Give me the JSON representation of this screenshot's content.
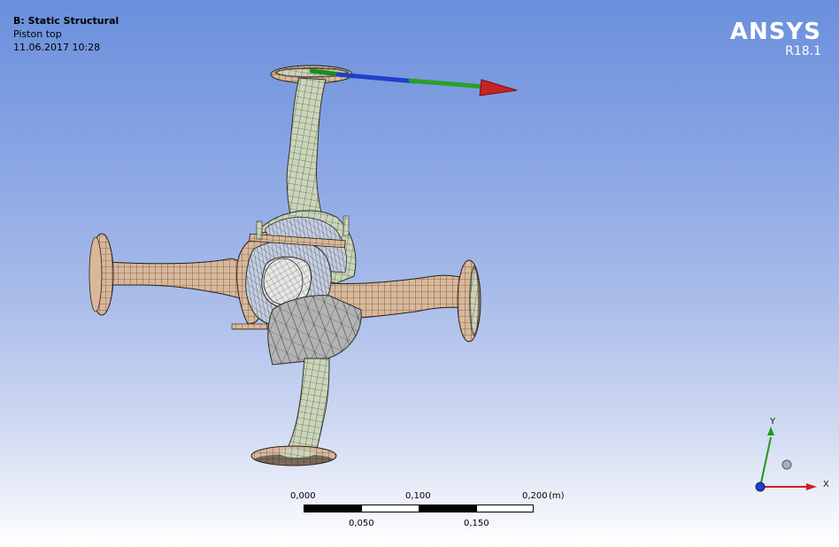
{
  "info": {
    "analysis_title": "B: Static Structural",
    "result_name": "Piston top",
    "timestamp": "11.06.2017 10:28"
  },
  "brand": {
    "logo": "ANSYS",
    "version": "R18.1"
  },
  "scale": {
    "top_labels": [
      "0,000",
      "0,100",
      "0,200"
    ],
    "unit": "(m)",
    "bottom_labels": [
      "0,050",
      "0,150"
    ]
  },
  "triad": {
    "y_label": "Y",
    "x_label": "X"
  },
  "colors": {
    "background_top": "#6b8fdc",
    "background_bottom": "#ffffff",
    "mesh_tan": "#d9b89a",
    "mesh_green": "#c9d3b8",
    "mesh_gray": "#b5b5b5",
    "arrow_red": "#d62a2a",
    "arrow_green": "#2aa02a",
    "arrow_blue": "#1f3fc8"
  }
}
